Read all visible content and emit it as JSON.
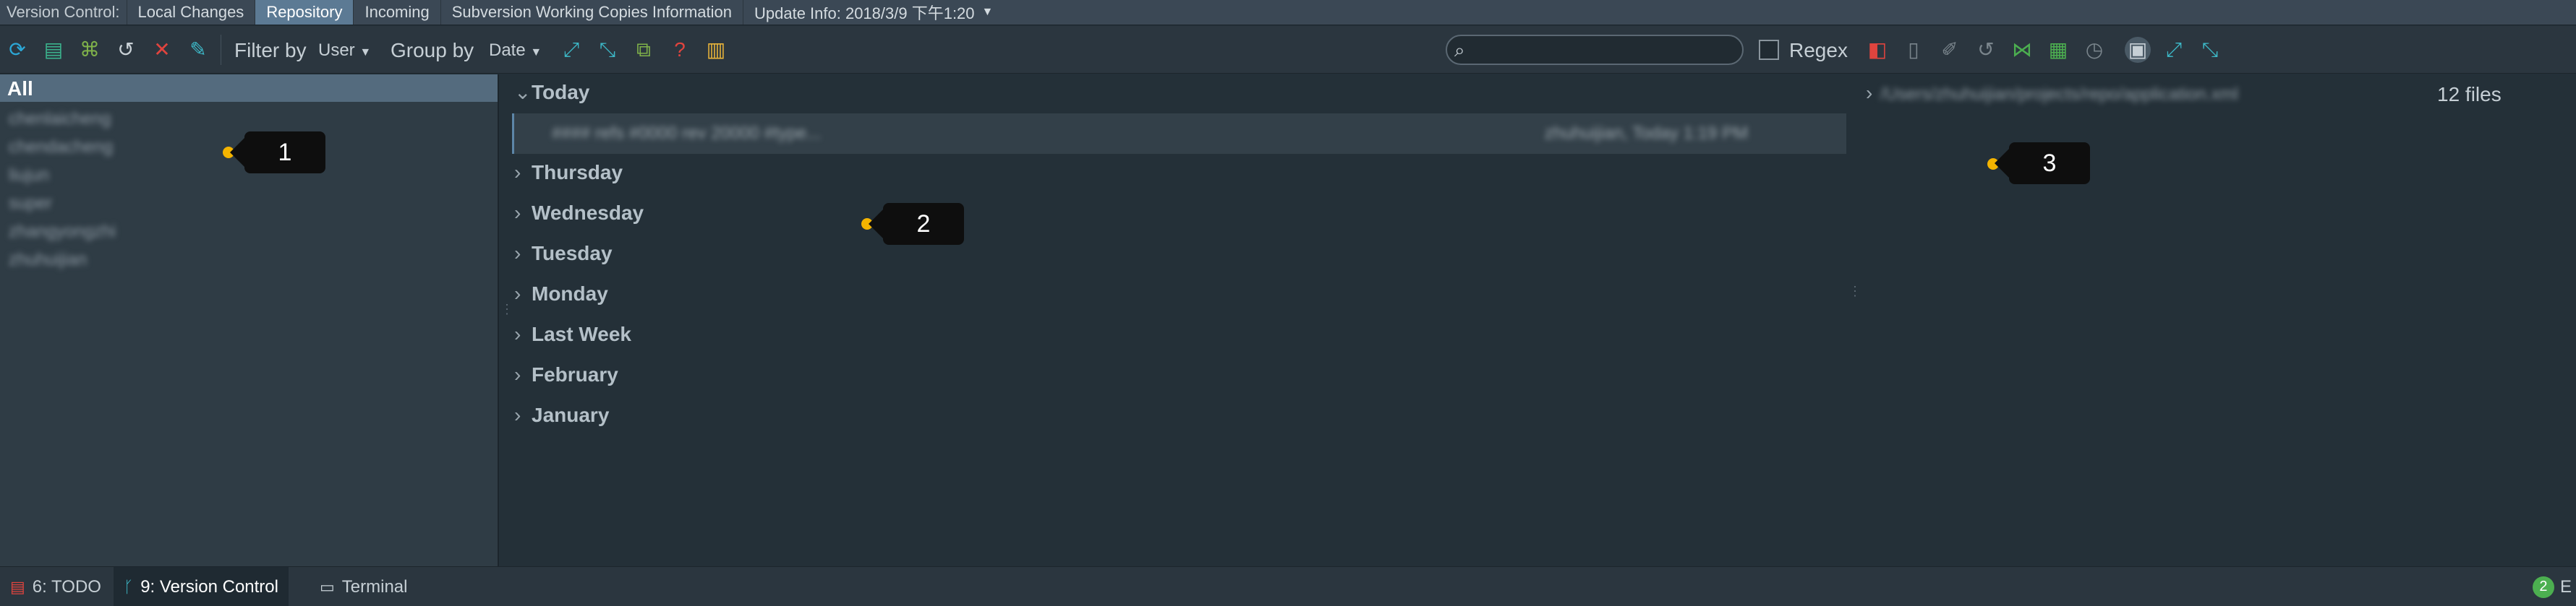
{
  "tabbar": {
    "label": "Version Control:",
    "tabs": [
      {
        "label": "Local Changes"
      },
      {
        "label": "Repository"
      },
      {
        "label": "Incoming"
      },
      {
        "label": "Subversion Working Copies Information"
      },
      {
        "label": "Update Info: 2018/3/9 下午1:20"
      }
    ],
    "active_tab": "Repository"
  },
  "toolbar": {
    "filter_label": "Filter by",
    "filter_value": "User",
    "group_label": "Group by",
    "group_value": "Date",
    "search_placeholder": "",
    "regex_label": "Regex",
    "icons": [
      "refresh-icon",
      "commit-message-icon",
      "structure-icon",
      "history-icon",
      "close-icon",
      "edit-icon",
      "expand-all-icon",
      "collapse-all-icon",
      "copy-icon",
      "help-icon",
      "settings-icon",
      "diff-icon",
      "file-icon",
      "brush-icon",
      "revert-icon",
      "merge-icon",
      "excel-icon",
      "clock-icon",
      "folder-icon",
      "expand-icon",
      "collapse-icon"
    ]
  },
  "left_panel": {
    "all_label": "All",
    "users": [
      "chenlaicheng",
      "chendacheng",
      "liujun",
      "super",
      "zhangyongzhi",
      "zhuhuijian"
    ]
  },
  "middle_panel": {
    "groups": [
      {
        "label": "Today",
        "expanded": true
      },
      {
        "label": "Thursday",
        "expanded": false
      },
      {
        "label": "Wednesday",
        "expanded": false
      },
      {
        "label": "Tuesday",
        "expanded": false
      },
      {
        "label": "Monday",
        "expanded": false
      },
      {
        "label": "Last Week",
        "expanded": false
      },
      {
        "label": "February",
        "expanded": false
      },
      {
        "label": "January",
        "expanded": false
      }
    ],
    "commit": {
      "message": "#### refs #0000 rev 20000 #type...",
      "meta": "zhuhuijian, Today 1:19 PM"
    }
  },
  "right_panel": {
    "path": "/Users/zhuhuijian/projects/repo/application.xml",
    "count": "12 files"
  },
  "callouts": [
    "1",
    "2",
    "3"
  ],
  "statusbar": {
    "tabs": [
      {
        "label": "6: TODO"
      },
      {
        "label": "9: Version Control"
      },
      {
        "label": "Terminal"
      }
    ],
    "event_count": "2",
    "event_label": "E"
  },
  "colors": {
    "background": "#243038",
    "accent": "#5c7a94",
    "callout_dot": "#f4b400"
  }
}
